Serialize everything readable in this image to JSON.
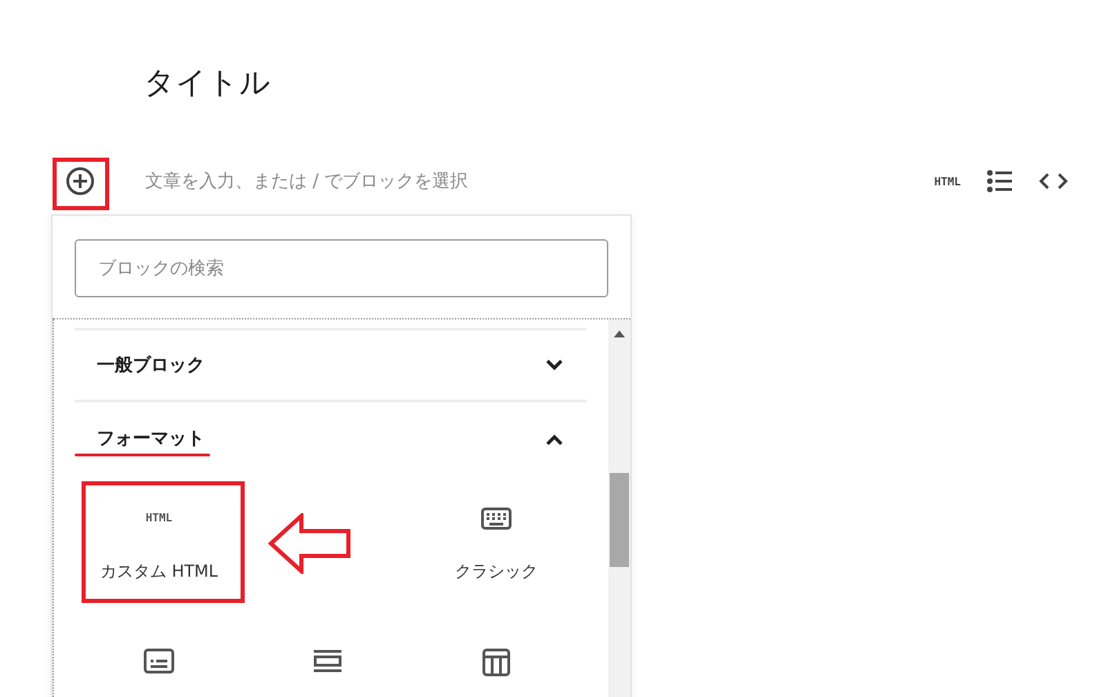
{
  "post_title": "タイトル",
  "block_placeholder": "文章を入力、または / でブロックを選択",
  "toolbar": [
    {
      "kind": "html",
      "label": "HTML"
    },
    {
      "kind": "list"
    },
    {
      "kind": "code"
    }
  ],
  "inserter": {
    "search": {
      "placeholder": "ブロックの検索"
    },
    "sections": [
      {
        "title": "一般ブロック",
        "expanded": false
      },
      {
        "title": "フォーマット",
        "expanded": true,
        "items": [
          {
            "kind": "html",
            "icon_text": "HTML",
            "label": "カスタム HTML"
          },
          {
            "kind": "empty"
          },
          {
            "kind": "keyboard",
            "label": "クラシック"
          },
          {
            "kind": "card"
          },
          {
            "kind": "bars"
          },
          {
            "kind": "table"
          }
        ]
      }
    ]
  }
}
